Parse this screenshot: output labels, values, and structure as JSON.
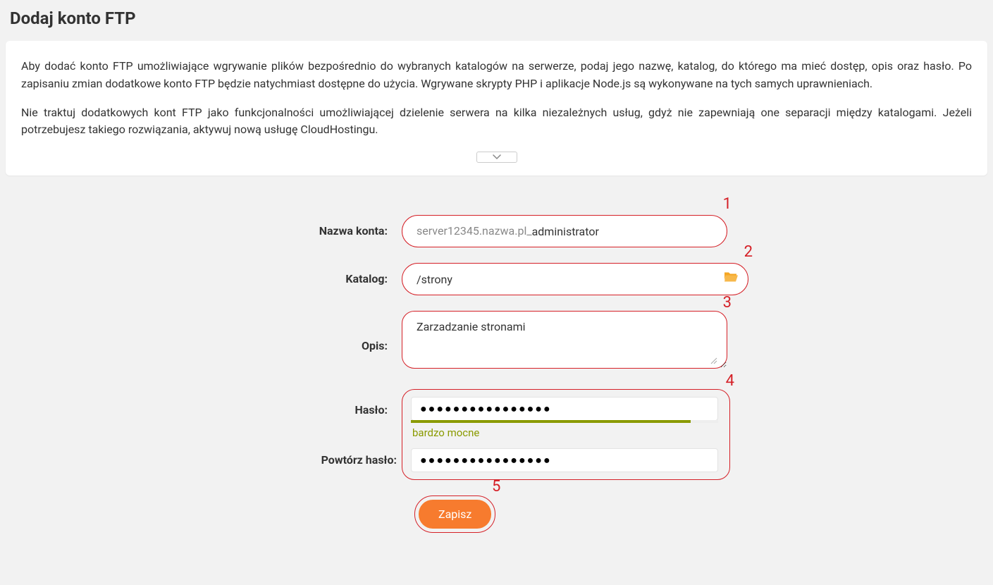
{
  "page_title": "Dodaj konto FTP",
  "info": {
    "p1": "Aby dodać konto FTP umożliwiające wgrywanie plików bezpośrednio do wybranych katalogów na serwerze, podaj jego nazwę, katalog, do którego ma mieć dostęp, opis oraz hasło. Po zapisaniu zmian dodatkowe konto FTP będzie natychmiast dostępne do użycia. Wgrywane skrypty PHP i aplikacje Node.js są wykonywane na tych samych uprawnieniach.",
    "p2": "Nie traktuj dodatkowych kont FTP jako funkcjonalności umożliwiającej dzielenie serwera na kilka niezależnych usług, gdyż nie zapewniają one separacji między katalogami. Jeżeli potrzebujesz takiego rozwiązania, aktywuj nową usługę CloudHostingu."
  },
  "form": {
    "account_label": "Nazwa konta:",
    "account_prefix": "server12345.nazwa.pl_",
    "account_value": "administrator",
    "directory_label": "Katalog:",
    "directory_value": "/strony",
    "description_label": "Opis:",
    "description_value": "Zarzadzanie stronami",
    "password_label": "Hasło:",
    "password_value": "●●●●●●●●●●●●●●●●",
    "password_strength": "bardzo mocne",
    "password_repeat_label": "Powtórz hasło:",
    "password_repeat_value": "●●●●●●●●●●●●●●●●",
    "submit_label": "Zapisz"
  },
  "steps": {
    "s1": "1",
    "s2": "2",
    "s3": "3",
    "s4": "4",
    "s5": "5"
  }
}
